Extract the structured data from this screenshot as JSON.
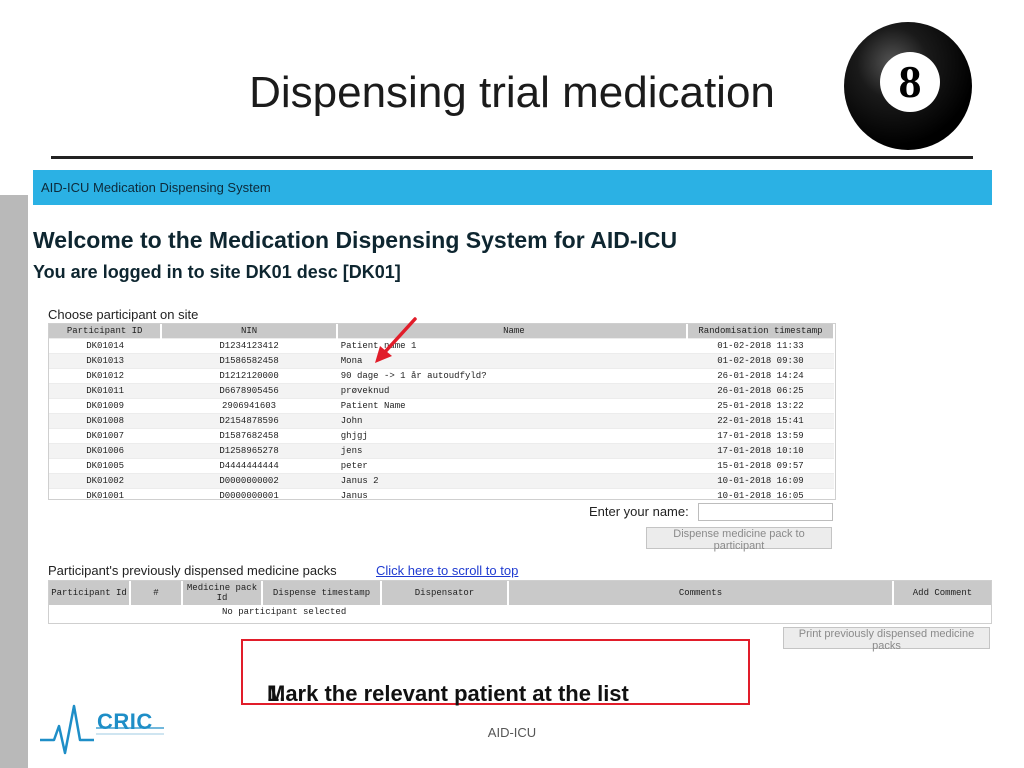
{
  "slide": {
    "title": "Dispensing trial medication",
    "footer": "AID-ICU",
    "logo_text": "CRIC",
    "badge_text": "8",
    "callout": {
      "number": "1.",
      "text": "Mark the relevant patient at the list"
    }
  },
  "app": {
    "header": "AID-ICU Medication Dispensing System",
    "welcome": "Welcome to the Medication Dispensing System for AID-ICU",
    "logged_in": "You are logged in to site DK01 desc [DK01]",
    "choose_label": "Choose participant on site",
    "participants": {
      "headers": [
        "Participant ID",
        "NIN",
        "Name",
        "Randomisation timestamp"
      ],
      "rows": [
        [
          "DK01014",
          "D1234123412",
          "Patient name 1",
          "01-02-2018 11:33"
        ],
        [
          "DK01013",
          "D1586582458",
          "Mona",
          "01-02-2018 09:30"
        ],
        [
          "DK01012",
          "D1212120000",
          "90 dage -> 1 år autoudfyld?",
          "26-01-2018 14:24"
        ],
        [
          "DK01011",
          "D6678905456",
          "prøveknud",
          "26-01-2018 06:25"
        ],
        [
          "DK01009",
          "2906941603",
          "Patient Name",
          "25-01-2018 13:22"
        ],
        [
          "DK01008",
          "D2154878596",
          "John",
          "22-01-2018 15:41"
        ],
        [
          "DK01007",
          "D1587682458",
          "ghjgj",
          "17-01-2018 13:59"
        ],
        [
          "DK01006",
          "D1258965278",
          "jens",
          "17-01-2018 10:10"
        ],
        [
          "DK01005",
          "D4444444444",
          "peter",
          "15-01-2018 09:57"
        ],
        [
          "DK01002",
          "D0000000002",
          "Janus 2",
          "10-01-2018 16:09"
        ],
        [
          "DK01001",
          "D0000000001",
          "Janus",
          "10-01-2018 16:05"
        ]
      ]
    },
    "enter_name_label": "Enter your name:",
    "name_value": "",
    "dispense_button": "Dispense medicine pack to participant",
    "prev_label": "Participant's previously dispensed medicine packs",
    "scroll_link": "Click here to scroll to top",
    "packs": {
      "headers": [
        "Participant Id",
        "#",
        "Medicine pack Id",
        "Dispense timestamp",
        "Dispensator",
        "Comments",
        "Add Comment"
      ],
      "empty": "No participant selected"
    },
    "print_button": "Print previously dispensed medicine packs"
  },
  "colors": {
    "header_bg": "#2bb1e4",
    "callout_border": "#e11d2a",
    "arrow": "#e11d2a",
    "link": "#1f3bd1",
    "logo": "#1e8ec7"
  },
  "icons": {
    "badge": "eight-ball-icon",
    "arrow": "red-arrow-icon",
    "logo": "cric-pulse-logo"
  }
}
